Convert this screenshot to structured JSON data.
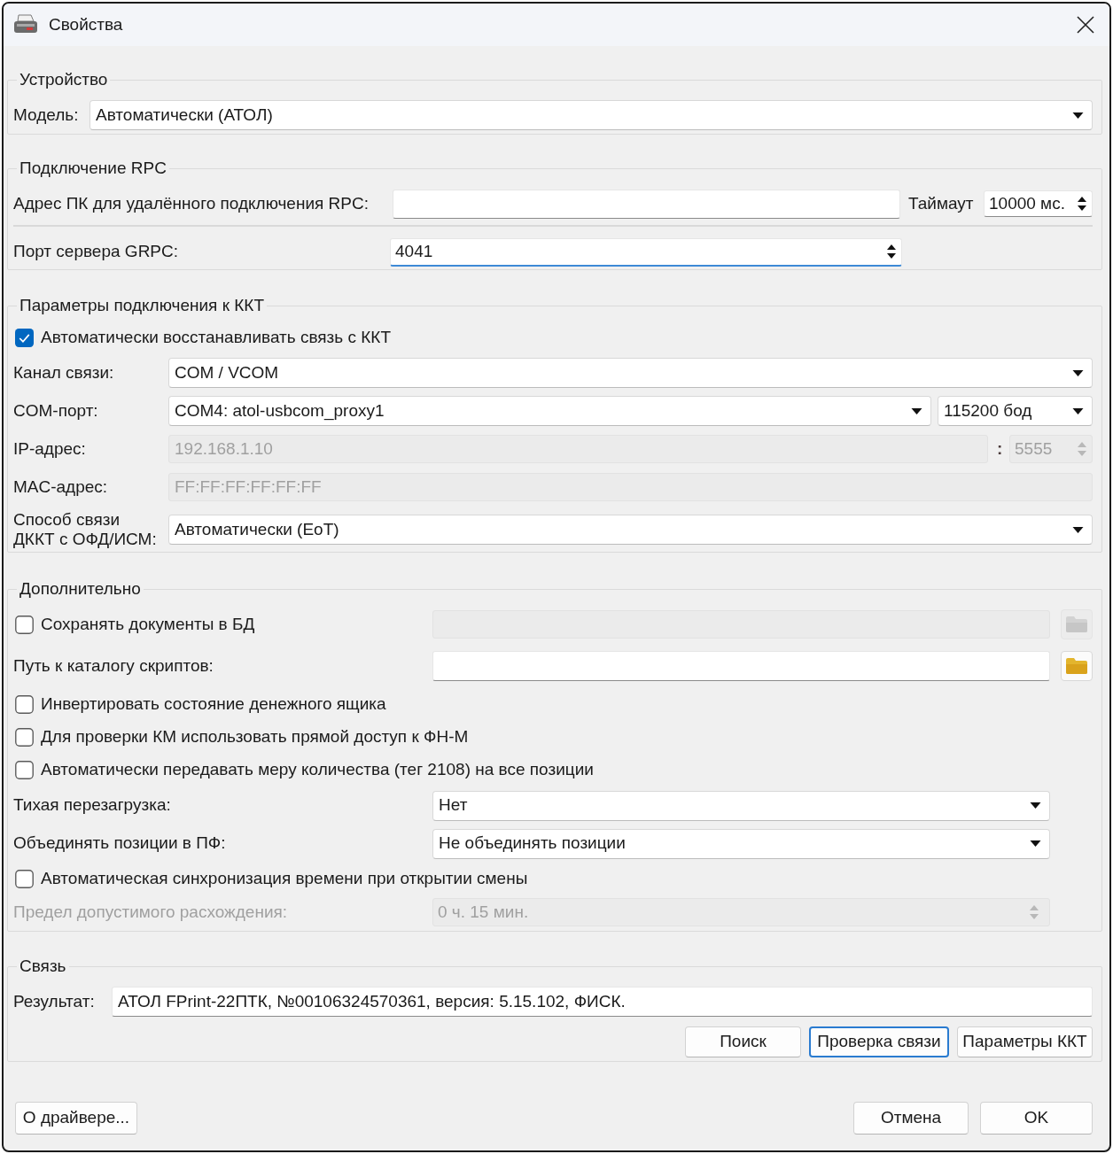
{
  "window": {
    "title": "Свойства"
  },
  "device": {
    "title": "Устройство",
    "model": {
      "label": "Модель:",
      "value": "Автоматически (АТОЛ)"
    }
  },
  "rpc": {
    "title": "Подключение RPC",
    "address": {
      "label": "Адрес ПК для удалённого подключения RPC:"
    },
    "timeout": {
      "label": "Таймаут",
      "value": "10000 мс."
    },
    "grpc_port": {
      "label": "Порт сервера GRPC:",
      "value": "4041",
      "focused": true
    }
  },
  "kkt": {
    "title": "Параметры подключения к ККТ",
    "auto_reconnect": {
      "label": "Автоматически восстанавливать связь с ККТ",
      "checked": true
    },
    "rows": [
      {
        "kind": "combo",
        "label": "Канал связи:",
        "value": "COM / VCOM"
      },
      {
        "kind": "port_combo",
        "label": "COM-порт:",
        "value": "COM4: atol-usbcom_proxy1",
        "baud": "115200 бод"
      },
      {
        "kind": "address",
        "label": "IP-адрес:",
        "value": "192.168.1.10",
        "separator": ":",
        "port": "5555",
        "disabled": true
      },
      {
        "kind": "text",
        "label": "MAC-адрес:",
        "value": "FF:FF:FF:FF:FF:FF",
        "disabled": true
      },
      {
        "kind": "combo",
        "label": "Способ связи ДККТ с ОФД/ИСМ:",
        "value": "Автоматически (EoT)"
      }
    ]
  },
  "extra": {
    "title": "Дополнительно",
    "rows": [
      {
        "kind": "checkbox_path",
        "label": "Сохранять документы в БД",
        "checked": false,
        "disabled": true
      },
      {
        "kind": "path",
        "label": "Путь к каталогу скриптов:",
        "disabled": false
      },
      {
        "kind": "checkbox",
        "label": "Инвертировать состояние денежного ящика",
        "checked": false
      },
      {
        "kind": "checkbox",
        "label": "Для проверки КМ использовать прямой доступ к ФН-М",
        "checked": false
      },
      {
        "kind": "checkbox",
        "label": "Автоматически передавать меру количества (тег 2108) на все позиции",
        "checked": false
      },
      {
        "kind": "combo",
        "label": "Тихая перезагрузка:",
        "value": "Нет"
      },
      {
        "kind": "combo",
        "label": "Объединять позиции в ПФ:",
        "value": "Не объединять позиции"
      },
      {
        "kind": "checkbox",
        "label": "Автоматическая синхронизация времени при открытии смены",
        "checked": false
      },
      {
        "kind": "spin",
        "label": "Предел допустимого расхождения:",
        "value": "0 ч. 15 мин.",
        "disabled": true
      }
    ]
  },
  "link": {
    "title": "Связь",
    "result": {
      "label": "Результат:",
      "value": "АТОЛ FPrint-22ПТК, №00106324570361, версия: 5.15.102, ФИСК."
    },
    "buttons": [
      {
        "label": "Поиск",
        "focused": false
      },
      {
        "label": "Проверка связи",
        "focused": true
      },
      {
        "label": "Параметры ККТ",
        "focused": false
      }
    ]
  },
  "footer": {
    "about": "О драйвере...",
    "buttons": [
      {
        "label": "Отмена",
        "focused": false
      },
      {
        "label": "OK",
        "focused": false
      }
    ]
  }
}
